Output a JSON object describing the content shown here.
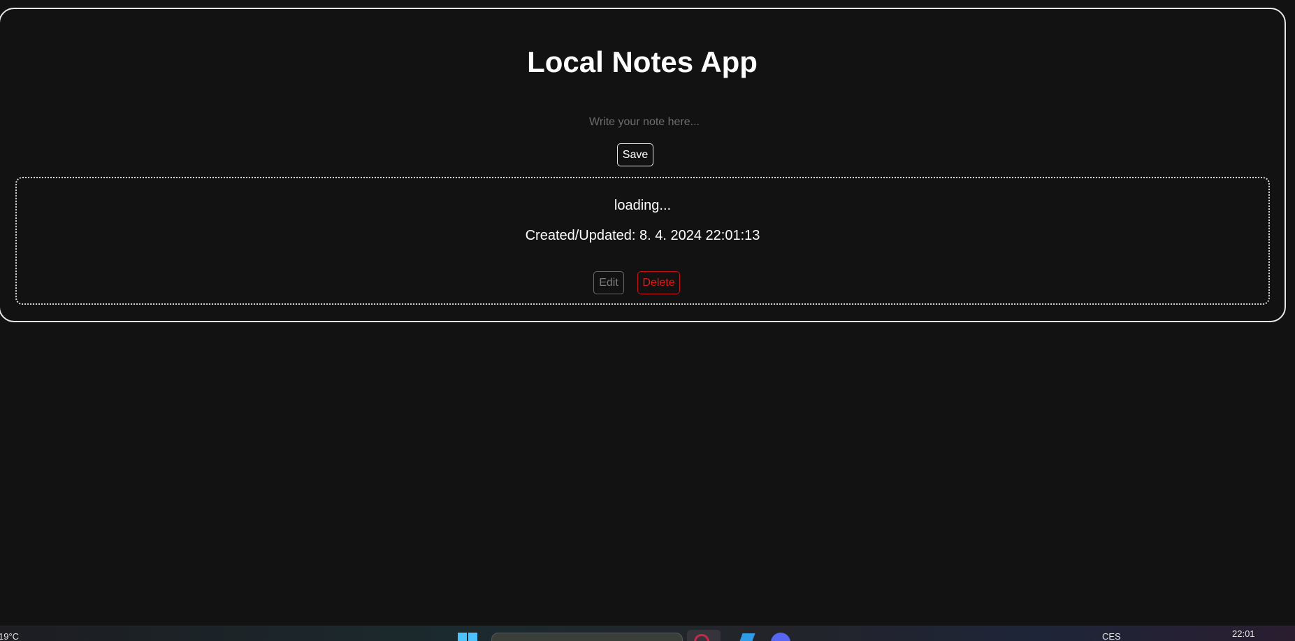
{
  "app": {
    "title": "Local Notes App",
    "input_placeholder": "Write your note here...",
    "input_value": "",
    "save_label": "Save"
  },
  "notes": [
    {
      "text": "loading...",
      "timestamp": "Created/Updated: 8. 4. 2024 22:01:13",
      "edit_label": "Edit",
      "delete_label": "Delete"
    }
  ],
  "taskbar": {
    "weather": "19°C",
    "language": "CES",
    "clock": "22:01",
    "icons": [
      "windows-start-icon",
      "taskbar-search-box",
      "opera-icon",
      "vscode-icon",
      "discord-icon"
    ]
  },
  "colors": {
    "background": "#121212",
    "border": "#e8e8e8",
    "delete": "#e01818",
    "edit_muted": "#7a7a7a"
  }
}
